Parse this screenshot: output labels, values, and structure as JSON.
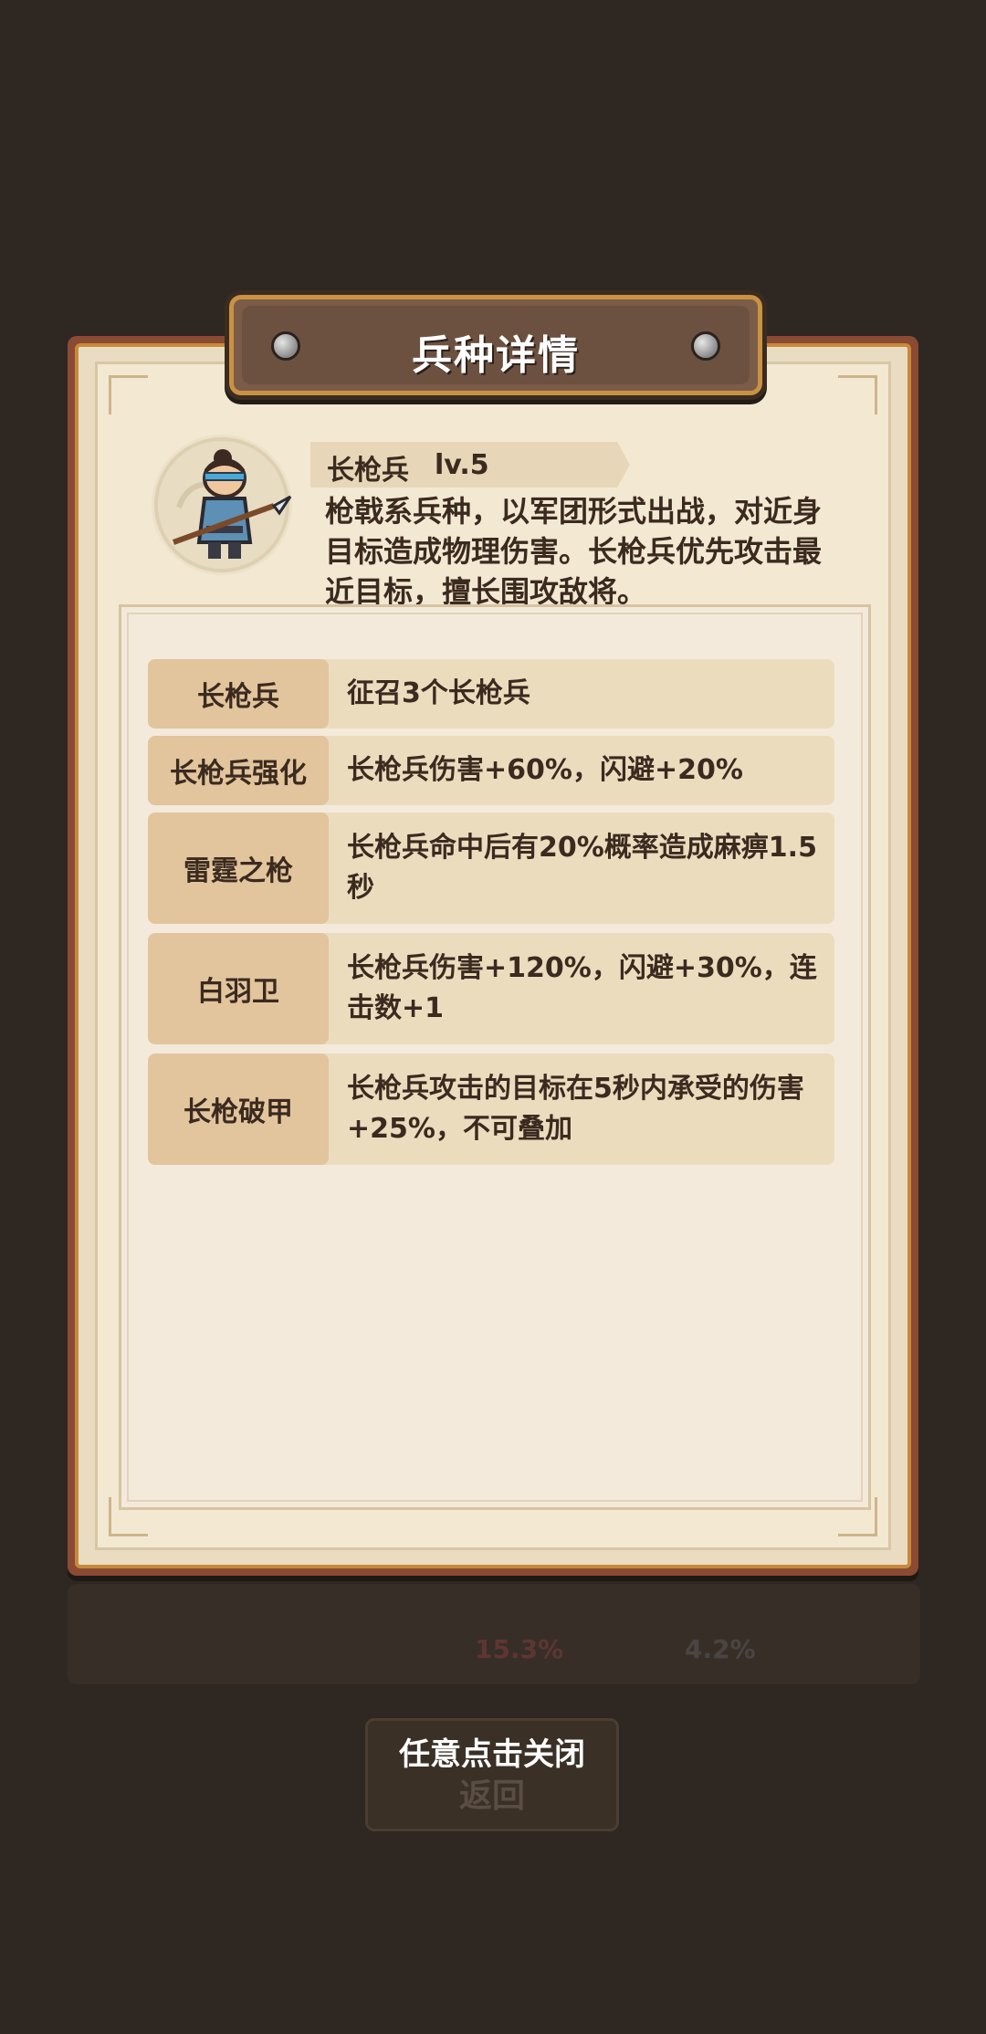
{
  "dialog": {
    "title": "兵种详情"
  },
  "unit": {
    "name": "长枪兵",
    "level": "lv.5",
    "description": "枪戟系兵种，以军团形式出战，对近身目标造成物理伤害。长枪兵优先攻击最近目标，擅长围攻敌将。",
    "portrait_icon": "spearman-avatar"
  },
  "skills": [
    {
      "name": "长枪兵",
      "effect": "征召3个长枪兵"
    },
    {
      "name": "长枪兵强化",
      "effect": "长枪兵伤害+60%，闪避+20%"
    },
    {
      "name": "雷霆之枪",
      "effect": "长枪兵命中后有20%概率造成麻痹1.5秒"
    },
    {
      "name": "白羽卫",
      "effect": "长枪兵伤害+120%，闪避+30%，连击数+1"
    },
    {
      "name": "长枪破甲",
      "effect": "长枪兵攻击的目标在5秒内承受的伤害+25%，不可叠加"
    }
  ],
  "background": {
    "stat_attack": "15.3%",
    "stat_defense": "4.2%",
    "back_button": "返回"
  },
  "hint": {
    "close_text": "任意点击关闭"
  },
  "colors": {
    "backdrop": "#2e2722",
    "panel_frame": "#8a4a33",
    "parchment": "#f3e8d2",
    "label_bg": "#e2c59d",
    "row_bg": "#ecdcbe",
    "text": "#3b2a1f"
  }
}
